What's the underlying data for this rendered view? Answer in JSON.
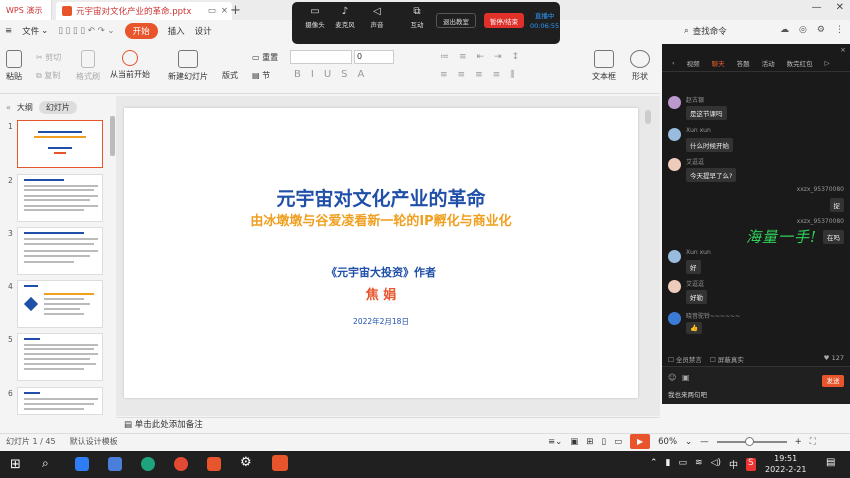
{
  "title_bar": {
    "app_tab": "WPS 演示",
    "doc_tab": "元宇宙对文化产业的革命.pptx",
    "new_tab": "+"
  },
  "menu": {
    "file": "文件",
    "start": "开始",
    "insert": "插入",
    "design": "设计",
    "search_cmd": "查找命令"
  },
  "live_toolbar": {
    "camera": "摄像头",
    "mic": "麦克风",
    "speaker": "声音",
    "interact": "互动",
    "exit_teaching": "退出教室",
    "pause_end": "暂停/结束",
    "live_status": "直播中",
    "live_time": "00:06:55"
  },
  "toolbar": {
    "paste": "粘贴",
    "cut": "剪切",
    "copy": "复制",
    "format_painter": "格式刷",
    "from_current": "从当前开始",
    "new_slide": "新建幻灯片",
    "layout": "版式",
    "reset": "重置",
    "section": "节",
    "font_size": "0",
    "textbox": "文本框",
    "shape": "形状"
  },
  "left_panel": {
    "outline_tab": "大纲",
    "slides_tab": "幻灯片",
    "thumbs": [
      "1",
      "2",
      "3",
      "4",
      "5",
      "6"
    ]
  },
  "slide": {
    "title": "元宇宙对文化产业的革命",
    "subtitle": "由冰墩墩与谷爱凌看新一轮的IP孵化与商业化",
    "book": "《元宇宙大投资》作者",
    "author": "焦 娟",
    "date": "2022年2月18日"
  },
  "notes_placeholder": "单击此处添加备注",
  "status": {
    "slide_count": "幻灯片 1 / 45",
    "template": "默认设计模板",
    "zoom": "60%"
  },
  "chat": {
    "tabs": [
      "视频",
      "聊天",
      "答题",
      "活动",
      "数完红包"
    ],
    "active_tab": "聊天",
    "messages": [
      {
        "user": "赵古银",
        "text": "是这节课吗"
      },
      {
        "user": "Xun xun",
        "text": "什么时候开始"
      },
      {
        "user": "艾逗逗",
        "text": "今天提早了么?"
      },
      {
        "user": "xxzx_95370080",
        "text": "捉",
        "self": true
      },
      {
        "user": "xxzx_95370080",
        "text": "在吗",
        "self": true
      },
      {
        "user": "Xun xun",
        "text": "好"
      },
      {
        "user": "艾逗逗",
        "text": "好勒"
      },
      {
        "user": "晓音驼铃~~~~~~",
        "text": "👍"
      }
    ],
    "filter_all": "全员禁言",
    "filter_hide": "屏蔽真实",
    "likes": "127",
    "input_text": "我也来两句吧",
    "send": "发送",
    "handwritten": "海量一手!"
  },
  "taskbar": {
    "time": "19:51",
    "date": "2022-2-21",
    "ime": "中"
  }
}
